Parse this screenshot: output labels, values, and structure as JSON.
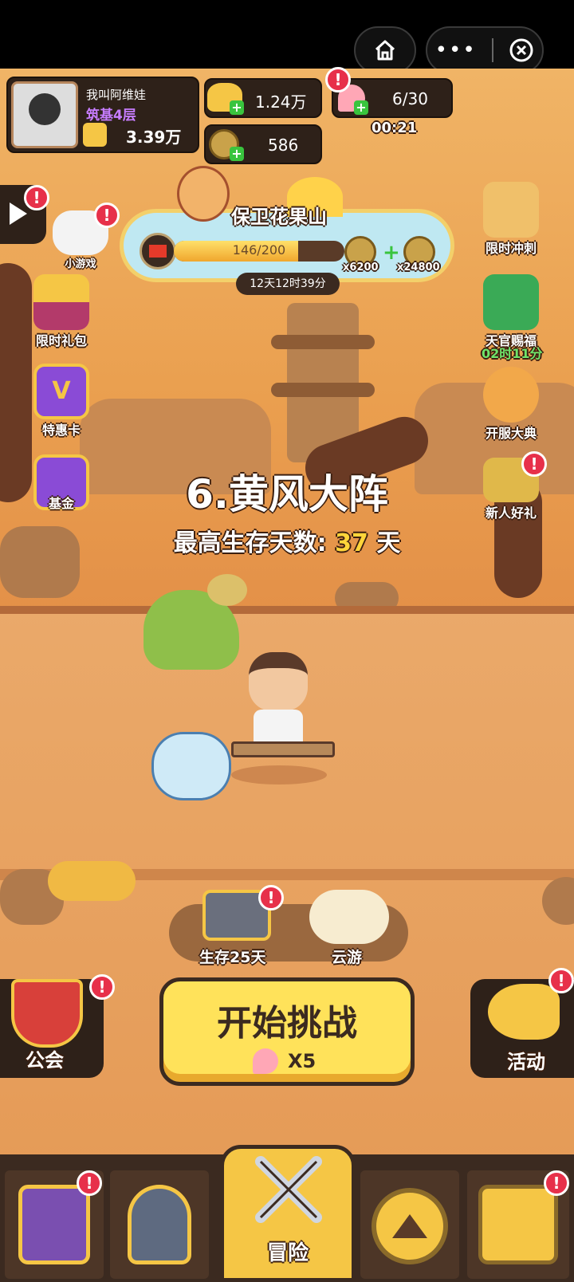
{
  "player": {
    "name": "我叫阿维娃",
    "realm": "筑基4层",
    "power": "3.39万"
  },
  "currency": {
    "gold": "1.24万",
    "coin": "586",
    "peach": "6/30",
    "peach_timer": "00:21"
  },
  "event": {
    "title": "保卫花果山",
    "progress_text": "146/200",
    "progress": 0.73,
    "reward1": "x6200",
    "reward2": "x24800",
    "countdown": "12天12时39分"
  },
  "left_menu": [
    "小游戏",
    "限时礼包",
    "特惠卡",
    "基金"
  ],
  "right_menu": {
    "limited_sprint": "限时冲刺",
    "blessing": "天官赐福",
    "blessing_timer": "02时11分",
    "server_open": "开服大典",
    "newbie_gift": "新人好礼"
  },
  "stage": {
    "name": "6.黄风大阵",
    "survival_label": "最高生存天数:",
    "survival_days": "37",
    "survival_unit": "天"
  },
  "chest": {
    "label": "生存25天"
  },
  "cloud": {
    "label": "云游"
  },
  "guild": {
    "label": "公会"
  },
  "activity": {
    "label": "活动"
  },
  "start": {
    "label": "开始挑战",
    "cost": "X5"
  },
  "nav": {
    "adventure": "冒险"
  },
  "colors": {
    "accent_yellow": "#ffd53a",
    "badge_red": "#e7304a",
    "realm_purple": "#c77dff",
    "timer_green": "#6ee36a"
  }
}
